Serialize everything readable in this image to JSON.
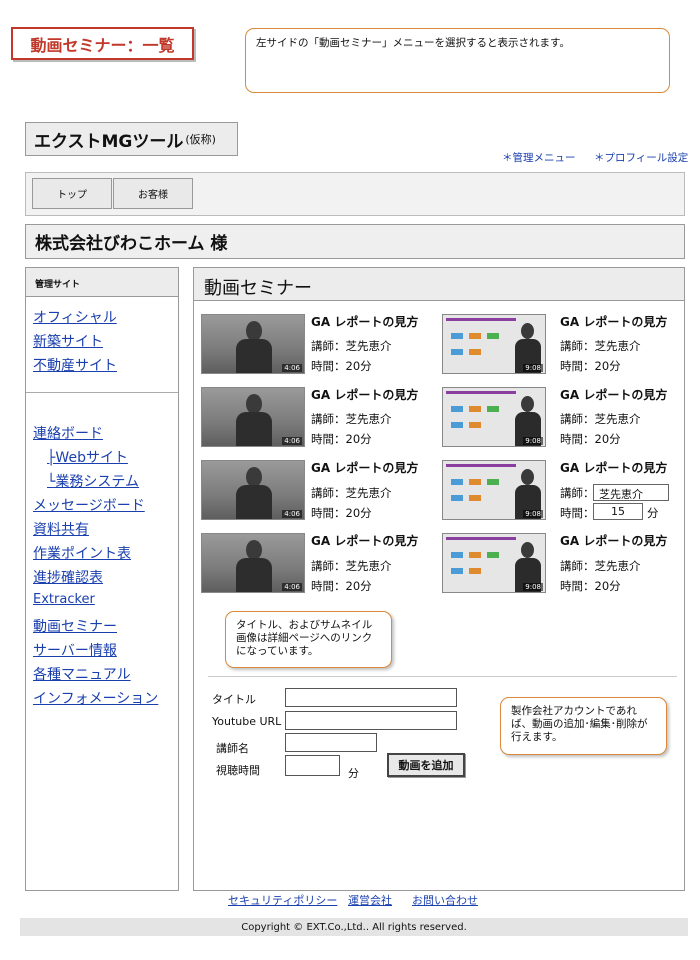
{
  "annotations": {
    "page_label": "動画セミナー：一覧",
    "top_note": "左サイドの「動画セミナー」メニューを選択すると表示されます。",
    "thumb_note": "タイトル、およびサムネイル画像は詳細ページへのリンクになっています。",
    "admin_note": "製作会社アカウントであれば、動画の追加･編集･削除が行えます。"
  },
  "header": {
    "app_title": "エクストMGツール",
    "app_title_suffix": "(仮称)",
    "links": [
      "管理メニュー",
      "プロフィール設定"
    ]
  },
  "nav": {
    "tabs": [
      "トップ",
      "お客様"
    ]
  },
  "client_name": "株式会社びわこホーム 様",
  "sidebar": {
    "heading": "管理サイト",
    "sites": [
      "オフィシャル",
      "新築サイト",
      "不動産サイト"
    ],
    "menu": [
      "連絡ボード",
      "├Webサイト",
      "└業務システム",
      "メッセージボード",
      "資料共有",
      "作業ポイント表",
      "進捗確認表",
      "Extracker",
      "動画セミナー",
      "サーバー情報",
      "各種マニュアル",
      "インフォメーション"
    ]
  },
  "main": {
    "title": "動画セミナー",
    "videos": [
      {
        "title": "GA レポートの見方",
        "lecturer": "講師：芝先恵介",
        "duration": "時間：20分",
        "thumb_time": "4:06"
      },
      {
        "title": "GA レポートの見方",
        "lecturer": "講師：芝先恵介",
        "duration": "時間：20分",
        "thumb_time": "9:08"
      },
      {
        "title": "GA レポートの見方",
        "lecturer": "講師：芝先恵介",
        "duration": "時間：20分",
        "thumb_time": "4:06"
      },
      {
        "title": "GA レポートの見方",
        "lecturer": "講師：芝先恵介",
        "duration": "時間：20分",
        "thumb_time": "9:08"
      },
      {
        "title": "GA レポートの見方",
        "lecturer": "講師：芝先恵介",
        "duration": "時間：20分",
        "thumb_time": "4:06"
      },
      {
        "title": "GA レポートの見方",
        "lecturer_label": "講師：",
        "lecturer_value": "芝先恵介",
        "duration_label": "時間：",
        "duration_value": "15",
        "duration_unit": "分",
        "thumb_time": "9:08"
      },
      {
        "title": "GA レポートの見方",
        "lecturer": "講師：芝先恵介",
        "duration": "時間：20分",
        "thumb_time": "4:06"
      },
      {
        "title": "GA レポートの見方",
        "lecturer": "講師：芝先恵介",
        "duration": "時間：20分",
        "thumb_time": "9:08"
      }
    ]
  },
  "form": {
    "title_label": "タイトル",
    "url_label": "Youtube URL",
    "lecturer_label": "講師名",
    "time_label": "視聴時間",
    "time_unit": "分",
    "add_button": "動画を追加"
  },
  "footer": {
    "links": [
      "セキュリティポリシー",
      "運営会社",
      "お問い合わせ"
    ],
    "copyright": "Copyright © EXT.Co.,Ltd.. All rights reserved."
  }
}
